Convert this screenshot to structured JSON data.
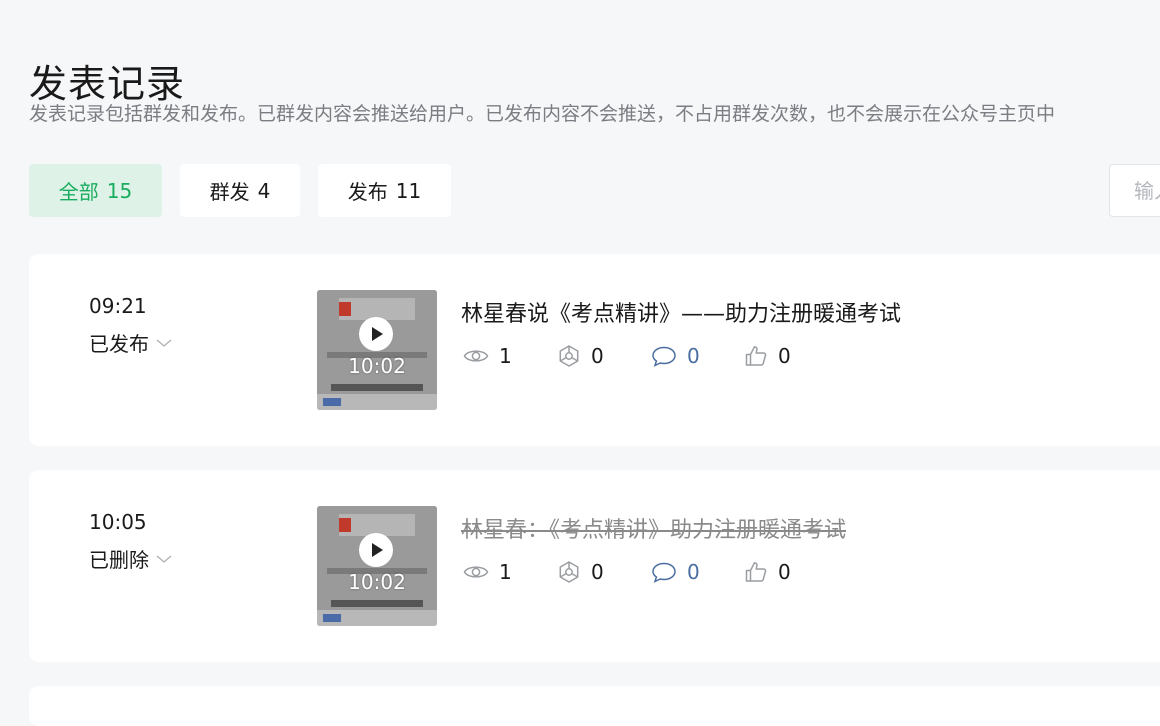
{
  "page": {
    "title": "发表记录",
    "description": "发表记录包括群发和发布。已群发内容会推送给用户。已发布内容不会推送，不占用群发次数，也不会展示在公众号主页中"
  },
  "tabs": [
    {
      "label": "全部",
      "count": "15",
      "active": true
    },
    {
      "label": "群发",
      "count": "4",
      "active": false
    },
    {
      "label": "发布",
      "count": "11",
      "active": false
    }
  ],
  "search": {
    "placeholder": "输入"
  },
  "colors": {
    "accent": "#1aad5f",
    "accent_bg": "#dff2e8",
    "comment_blue": "#4a6ea0"
  },
  "records": [
    {
      "time": "09:21",
      "status": "已发布",
      "thumbnail_duration": "10:02",
      "title": "林星春说《考点精讲》——助力注册暖通考试",
      "deleted": false,
      "stats": {
        "reads": "1",
        "shares": "0",
        "comments": "0",
        "likes": "0"
      }
    },
    {
      "time": "10:05",
      "status": "已删除",
      "thumbnail_duration": "10:02",
      "title": "林星春：《考点精讲》助力注册暖通考试",
      "deleted": true,
      "stats": {
        "reads": "1",
        "shares": "0",
        "comments": "0",
        "likes": "0"
      }
    }
  ],
  "icons": {
    "status_toggle": "chevron-down-icon",
    "reads": "eye-icon",
    "shares": "share-icon",
    "comments": "comment-icon",
    "likes": "thumbs-up-icon",
    "thumbnail_play": "play-icon"
  }
}
